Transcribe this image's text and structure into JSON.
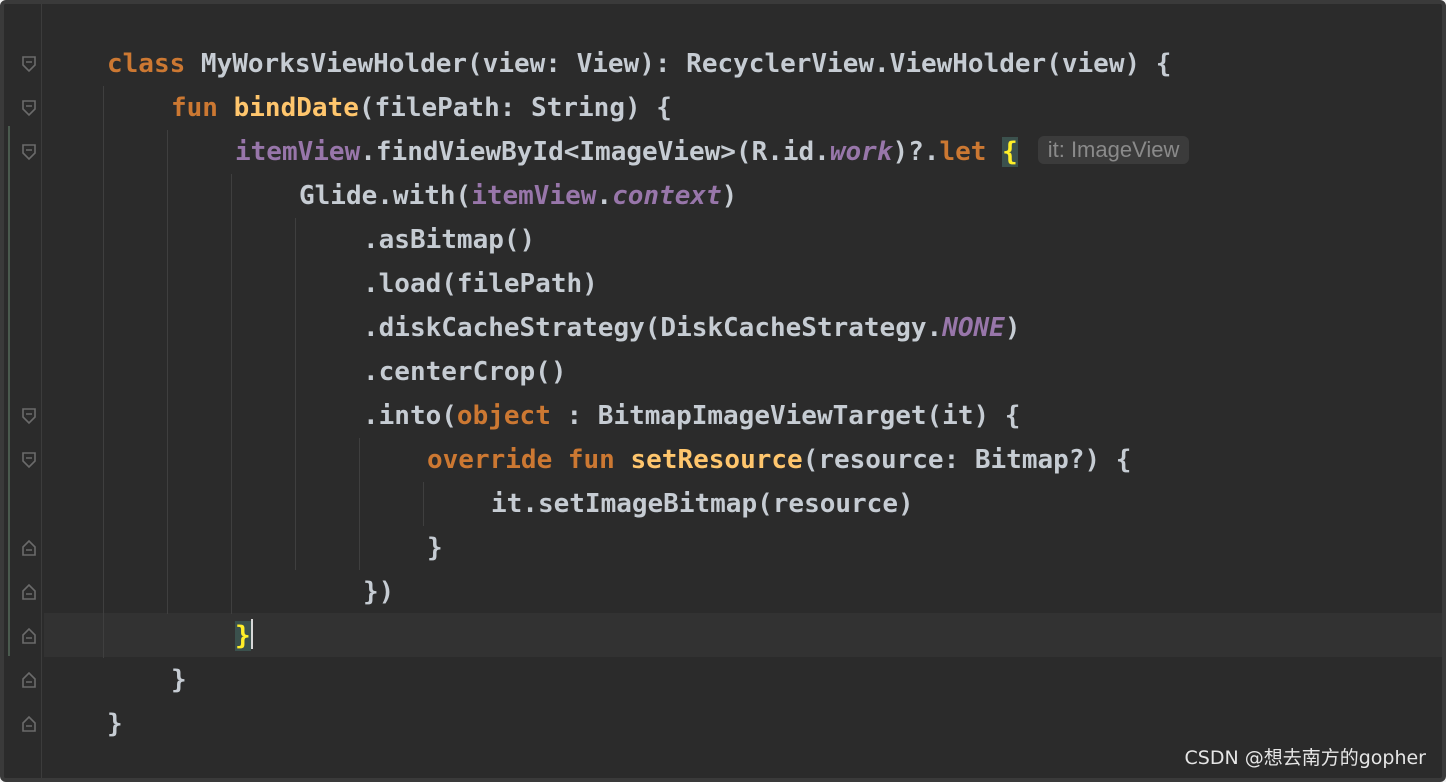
{
  "editor": {
    "lines": [
      [
        {
          "t": "class ",
          "c": "kw"
        },
        {
          "t": "MyWorksViewHolder(view: View): RecyclerView.ViewHolder(view) {"
        }
      ],
      [
        {
          "t": "fun ",
          "c": "kw"
        },
        {
          "t": "bindDate",
          "c": "fn"
        },
        {
          "t": "(filePath: String) {"
        }
      ],
      [
        {
          "t": "itemView",
          "c": "pr"
        },
        {
          "t": ".findViewById<ImageView>(R.id."
        },
        {
          "t": "work",
          "c": "it"
        },
        {
          "t": ")?."
        },
        {
          "t": "let",
          "c": "kw it-kw"
        },
        {
          "t": " "
        },
        {
          "t": "{",
          "c": "brace-hl"
        }
      ],
      [
        {
          "t": "Glide.with("
        },
        {
          "t": "itemView",
          "c": "pr"
        },
        {
          "t": "."
        },
        {
          "t": "context",
          "c": "it"
        },
        {
          "t": ")"
        }
      ],
      [
        {
          "t": ".asBitmap()"
        }
      ],
      [
        {
          "t": ".load(filePath)"
        }
      ],
      [
        {
          "t": ".diskCacheStrategy(DiskCacheStrategy."
        },
        {
          "t": "NONE",
          "c": "it"
        },
        {
          "t": ")"
        }
      ],
      [
        {
          "t": ".centerCrop()"
        }
      ],
      [
        {
          "t": ".into("
        },
        {
          "t": "object",
          "c": "kw"
        },
        {
          "t": " : BitmapImageViewTarget(it) {"
        }
      ],
      [
        {
          "t": "override fun ",
          "c": "kw"
        },
        {
          "t": "setResource",
          "c": "fn"
        },
        {
          "t": "(resource: Bitmap?) {"
        }
      ],
      [
        {
          "t": "it.setImageBitmap(resource)"
        }
      ],
      [
        {
          "t": "}"
        }
      ],
      [
        {
          "t": "})"
        }
      ],
      [
        {
          "t": "}",
          "c": "brace-hl"
        }
      ],
      [
        {
          "t": "}"
        }
      ],
      [
        {
          "t": "}"
        }
      ]
    ],
    "inlay_hint": "it: ImageView",
    "colors": {
      "background": "#2b2b2b",
      "keyword": "#cc7832",
      "function": "#ffc66d",
      "property": "#9876aa",
      "text": "#c6ccd3",
      "brace_highlight": "#ffef28"
    }
  },
  "watermark": "CSDN @想去南方的gopher"
}
